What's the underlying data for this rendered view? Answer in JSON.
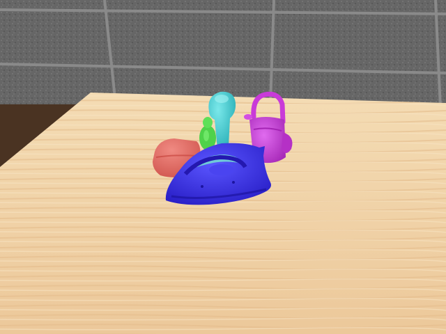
{
  "scene": {
    "objects": [
      {
        "name": "red-sponge",
        "color": "#e56a62"
      },
      {
        "name": "green-figurine",
        "color": "#4fd24a"
      },
      {
        "name": "cyan-vase",
        "color": "#42c9cf"
      },
      {
        "name": "magenta-watering-can",
        "color": "#c93ad8"
      },
      {
        "name": "blue-clothes-iron",
        "color": "#3a2fe0"
      }
    ],
    "table_color": "#f0d2a8",
    "wall_color": "#6a6a6a",
    "floor_color": "#4a3322"
  }
}
